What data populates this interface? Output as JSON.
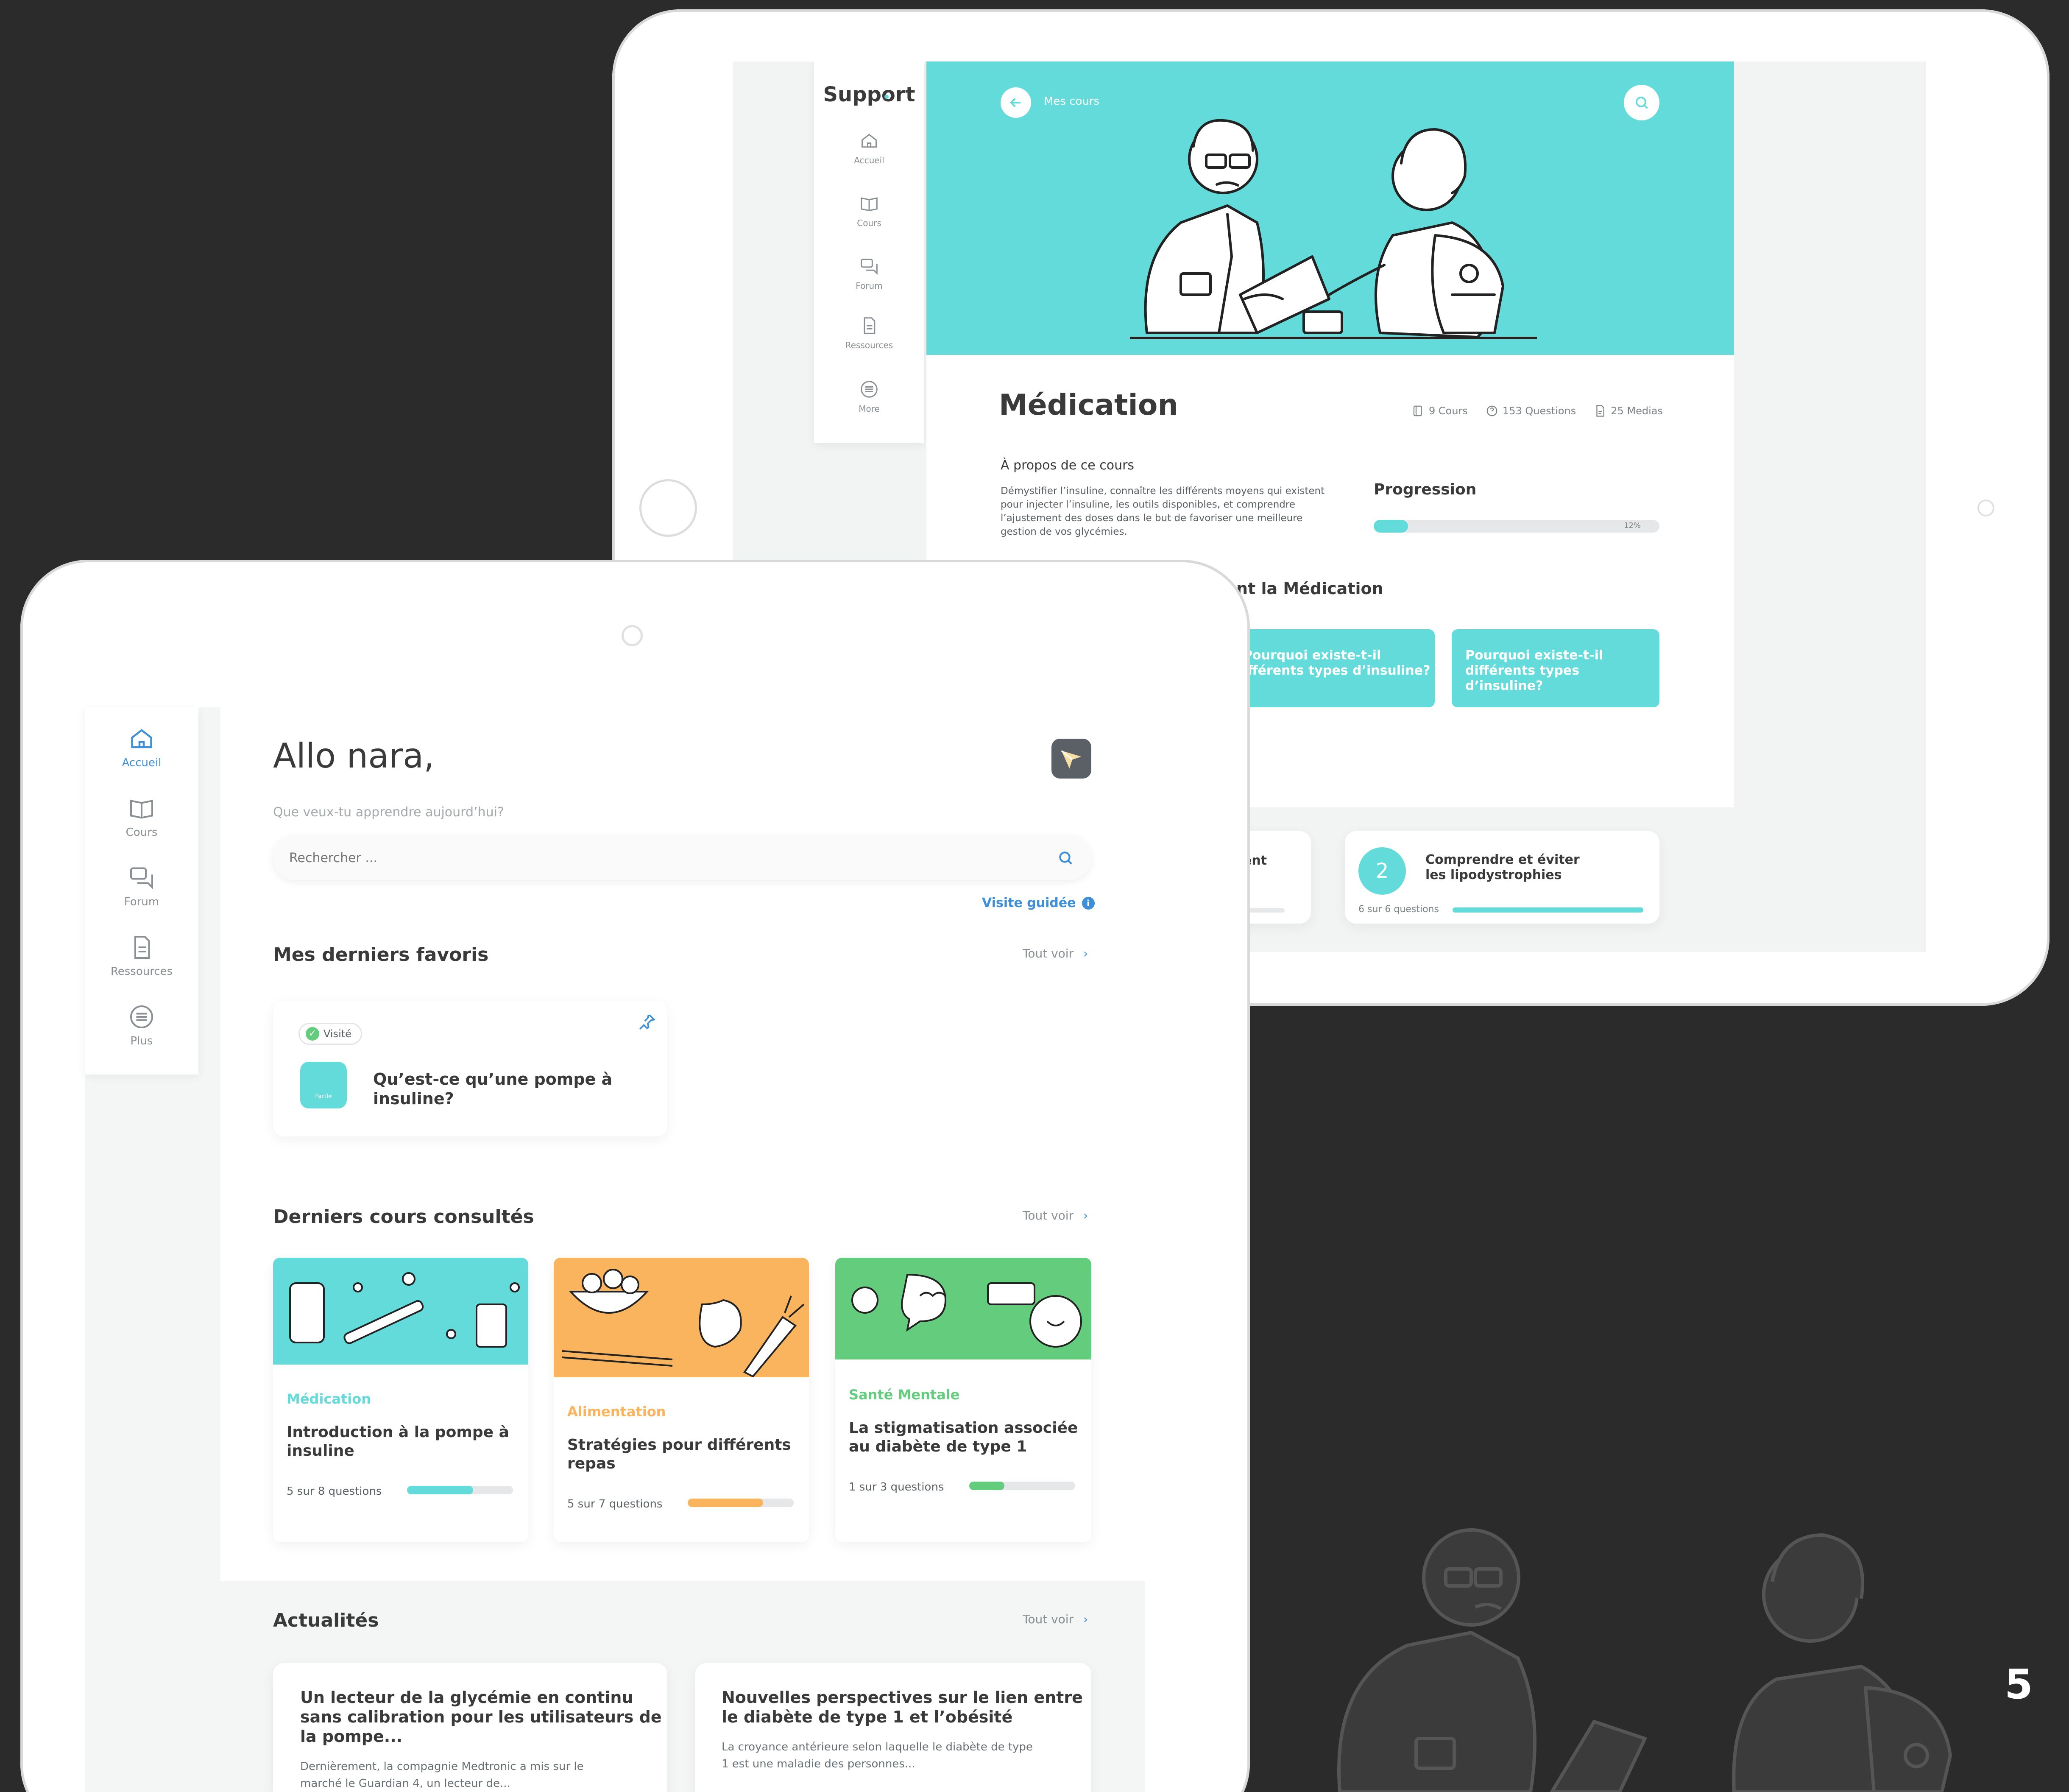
{
  "colors": {
    "teal": "#63dbdb",
    "orange": "#fbb45e",
    "green": "#63cd7d",
    "blue": "#3d8fd9",
    "dark": "#2b2b2b"
  },
  "page_number": "5",
  "back_screen": {
    "app_title": "Support",
    "nav": [
      {
        "label": "Accueil",
        "icon": "home-icon"
      },
      {
        "label": "Cours",
        "icon": "book-icon"
      },
      {
        "label": "Forum",
        "icon": "chat-icon"
      },
      {
        "label": "Ressources",
        "icon": "document-icon"
      },
      {
        "label": "More",
        "icon": "menu-icon"
      }
    ],
    "header": {
      "back_label": "Mes cours"
    },
    "course": {
      "title": "Médication",
      "stats": [
        {
          "icon": "course-icon",
          "text": "9 Cours"
        },
        {
          "icon": "question-icon",
          "text": "153 Questions"
        },
        {
          "icon": "media-icon",
          "text": "25 Medias"
        }
      ],
      "about_title": "À propos de ce cours",
      "about_text_lines": [
        "Démystifier l’insuline, connaître les différents moyens qui existent",
        "pour injecter l’insuline, les outils disponibles, et comprendre",
        "l’ajustement des doses dans le but de favoriser une meilleure",
        "gestion de vos glycémies."
      ],
      "progress_title": "Progression",
      "progress_value": 0.12,
      "progress_label": "12%",
      "section_title": "nt la Médication",
      "question_cards": [
        {
          "lines": [
            "Pourquoi existe-t-il",
            "ifférents types d’insuline?"
          ]
        },
        {
          "lines": [
            "Pourquoi existe-t-il",
            "différents types d’insuline?"
          ]
        }
      ],
      "lessons": [
        {
          "partial_text": "ent"
        },
        {
          "number": "2",
          "title_lines": [
            "Comprendre et éviter",
            "les lipodystrophies"
          ],
          "progress_text": "6 sur 6 questions",
          "progress": 1.0
        }
      ]
    }
  },
  "front_screen": {
    "nav": [
      {
        "label": "Accueil",
        "icon": "home-icon",
        "active": true
      },
      {
        "label": "Cours",
        "icon": "book-icon"
      },
      {
        "label": "Forum",
        "icon": "chat-icon"
      },
      {
        "label": "Ressources",
        "icon": "document-icon"
      },
      {
        "label": "Plus",
        "icon": "menu-icon"
      }
    ],
    "greeting": "Allo nara,",
    "subtitle": "Que veux-tu apprendre aujourd’hui?",
    "search_placeholder": "Rechercher ...",
    "guided_tour": "Visite guidée",
    "favorites": {
      "title": "Mes derniers favoris",
      "see_all": "Tout voir",
      "items": [
        {
          "badge": "Visité",
          "title_lines": [
            "Qu’est-ce qu’une pompe à",
            "insuline?"
          ],
          "thumb_label": "Facile"
        }
      ]
    },
    "recent": {
      "title": "Derniers cours consultés",
      "see_all": "Tout voir",
      "items": [
        {
          "category": "Médication",
          "title_lines": [
            "Introduction à la pompe à",
            "insuline"
          ],
          "progress_text": "5 sur 8 questions",
          "progress": 0.625,
          "color": "#63dbdb"
        },
        {
          "category": "Alimentation",
          "title_lines": [
            "Stratégies pour différents",
            "repas"
          ],
          "progress_text": "5 sur 7 questions",
          "progress": 0.71,
          "color": "#fbb45e"
        },
        {
          "category": "Santé Mentale",
          "title_lines": [
            "La stigmatisation associée",
            "au diabète de type 1"
          ],
          "progress_text": "1 sur 3 questions",
          "progress": 0.33,
          "color": "#63cd7d"
        }
      ]
    },
    "news": {
      "title": "Actualités",
      "see_all": "Tout voir",
      "items": [
        {
          "title_lines": [
            "Un lecteur de la glycémie en continu",
            "sans calibration pour les utilisateurs de",
            "la pompe..."
          ],
          "excerpt_lines": [
            "Dernièrement, la compagnie Medtronic a mis sur le",
            "marché le Guardian 4, un lecteur de..."
          ]
        },
        {
          "title_lines": [
            "Nouvelles perspectives sur le lien entre",
            "le diabète de type 1 et l’obésité"
          ],
          "excerpt_lines": [
            "La croyance antérieure selon laquelle le diabète de type",
            "1 est une maladie des personnes..."
          ]
        }
      ]
    }
  }
}
